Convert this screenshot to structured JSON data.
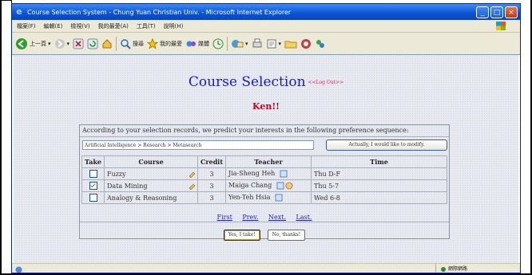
{
  "window": {
    "title": "Course Selection System - Chung Yuan Christian Univ. - Microsoft Internet Explorer",
    "buttons": {
      "minimize": "_",
      "maximize": "□",
      "close": "×"
    }
  },
  "menubar": {
    "items": [
      "檔案(F)",
      "編輯(E)",
      "檢視(V)",
      "我的最愛(A)",
      "工具(T)",
      "說明(H)"
    ]
  },
  "toolbar": {
    "back_label": "上一頁",
    "search_label": "搜尋",
    "favorites_label": "我的最愛",
    "media_label": "媒體",
    "icons": [
      "back-icon",
      "forward-icon",
      "stop-icon",
      "refresh-icon",
      "home-icon",
      "search-icon",
      "favorites-icon",
      "media-icon",
      "history-icon",
      "mail-icon",
      "print-icon",
      "edit-icon",
      "discuss-icon",
      "folder-icon",
      "messenger-icon"
    ]
  },
  "page": {
    "title": "Course Selection",
    "title_link": "<<Log Out>>",
    "greeting": "Ken!!",
    "message": "According to your selection records, we predict your interests in the following preference sequence:",
    "preference_sequence": "Artificial Intelligence > Research > Metasearch",
    "modify_button": "Actually, I would like to modify.",
    "table": {
      "headers": {
        "take": "Take",
        "course": "Course",
        "credit": "Credit",
        "teacher": "Teacher",
        "time": "Time"
      },
      "rows": [
        {
          "checked": false,
          "course": "Fuzzy",
          "credit": "3",
          "teacher": "Jia-Sheng Heh",
          "time": "Thu D-F",
          "teacher_icons": 1
        },
        {
          "checked": true,
          "course": "Data Mining",
          "credit": "3",
          "teacher": "Maiga Chang",
          "time": "Thu 5-7",
          "teacher_icons": 2
        },
        {
          "checked": false,
          "course": "Analogy & Reasoning",
          "credit": "3",
          "teacher": "Yen-Teh Hsia",
          "time": "Wed 6-8",
          "teacher_icons": 1
        }
      ]
    },
    "pager": {
      "first": "First",
      "prev": "Prev.",
      "next": "Next.",
      "last": "Last."
    },
    "actions": {
      "yes": "Yes, I take!",
      "no": "No, thanks!"
    }
  },
  "status": {
    "zone": "網際網路"
  },
  "colors": {
    "title": "#1a1ac8",
    "greeting": "#c00020",
    "link": "#2323b8",
    "titlebar": "#0b52d4"
  }
}
